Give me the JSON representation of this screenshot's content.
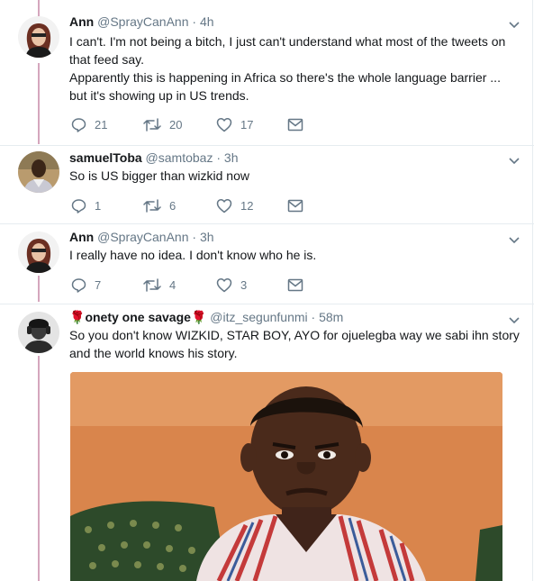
{
  "tweets": [
    {
      "name": "Ann",
      "handle": "@SprayCanAnn",
      "time": "4h",
      "text_lines": [
        "I can't. I'm not being a bitch, I just can't understand what most of the tweets on",
        "that feed say.",
        "Apparently this is happening in Africa so there's the whole language barrier ...",
        "but it's showing up in US trends."
      ],
      "replies": "21",
      "retweets": "20",
      "likes": "17"
    },
    {
      "name": "samuelToba",
      "handle": "@samtobaz",
      "time": "3h",
      "text_lines": [
        "So is US bigger than wizkid now"
      ],
      "replies": "1",
      "retweets": "6",
      "likes": "12"
    },
    {
      "name": "Ann",
      "handle": "@SprayCanAnn",
      "time": "3h",
      "text_lines": [
        "I really have no idea. I don't know who he is."
      ],
      "replies": "7",
      "retweets": "4",
      "likes": "3"
    },
    {
      "name": "onety one savage",
      "name_emoji": "🌹",
      "handle": "@itz_segunfunmi",
      "time": "58m",
      "text_lines": [
        "So you don't know WIZKID, STAR BOY, AYO for ojuelegba way we sabi ihn story",
        "and the world knows  his story."
      ]
    }
  ],
  "dot": "·",
  "icons": {
    "reply": "reply-icon",
    "retweet": "retweet-icon",
    "like": "heart-icon",
    "dm": "envelope-icon",
    "more": "chevron-down-icon"
  },
  "colors": {
    "thread_line": "#d5a6bd",
    "secondary_text": "#657786",
    "separator": "#e6ecf0"
  }
}
